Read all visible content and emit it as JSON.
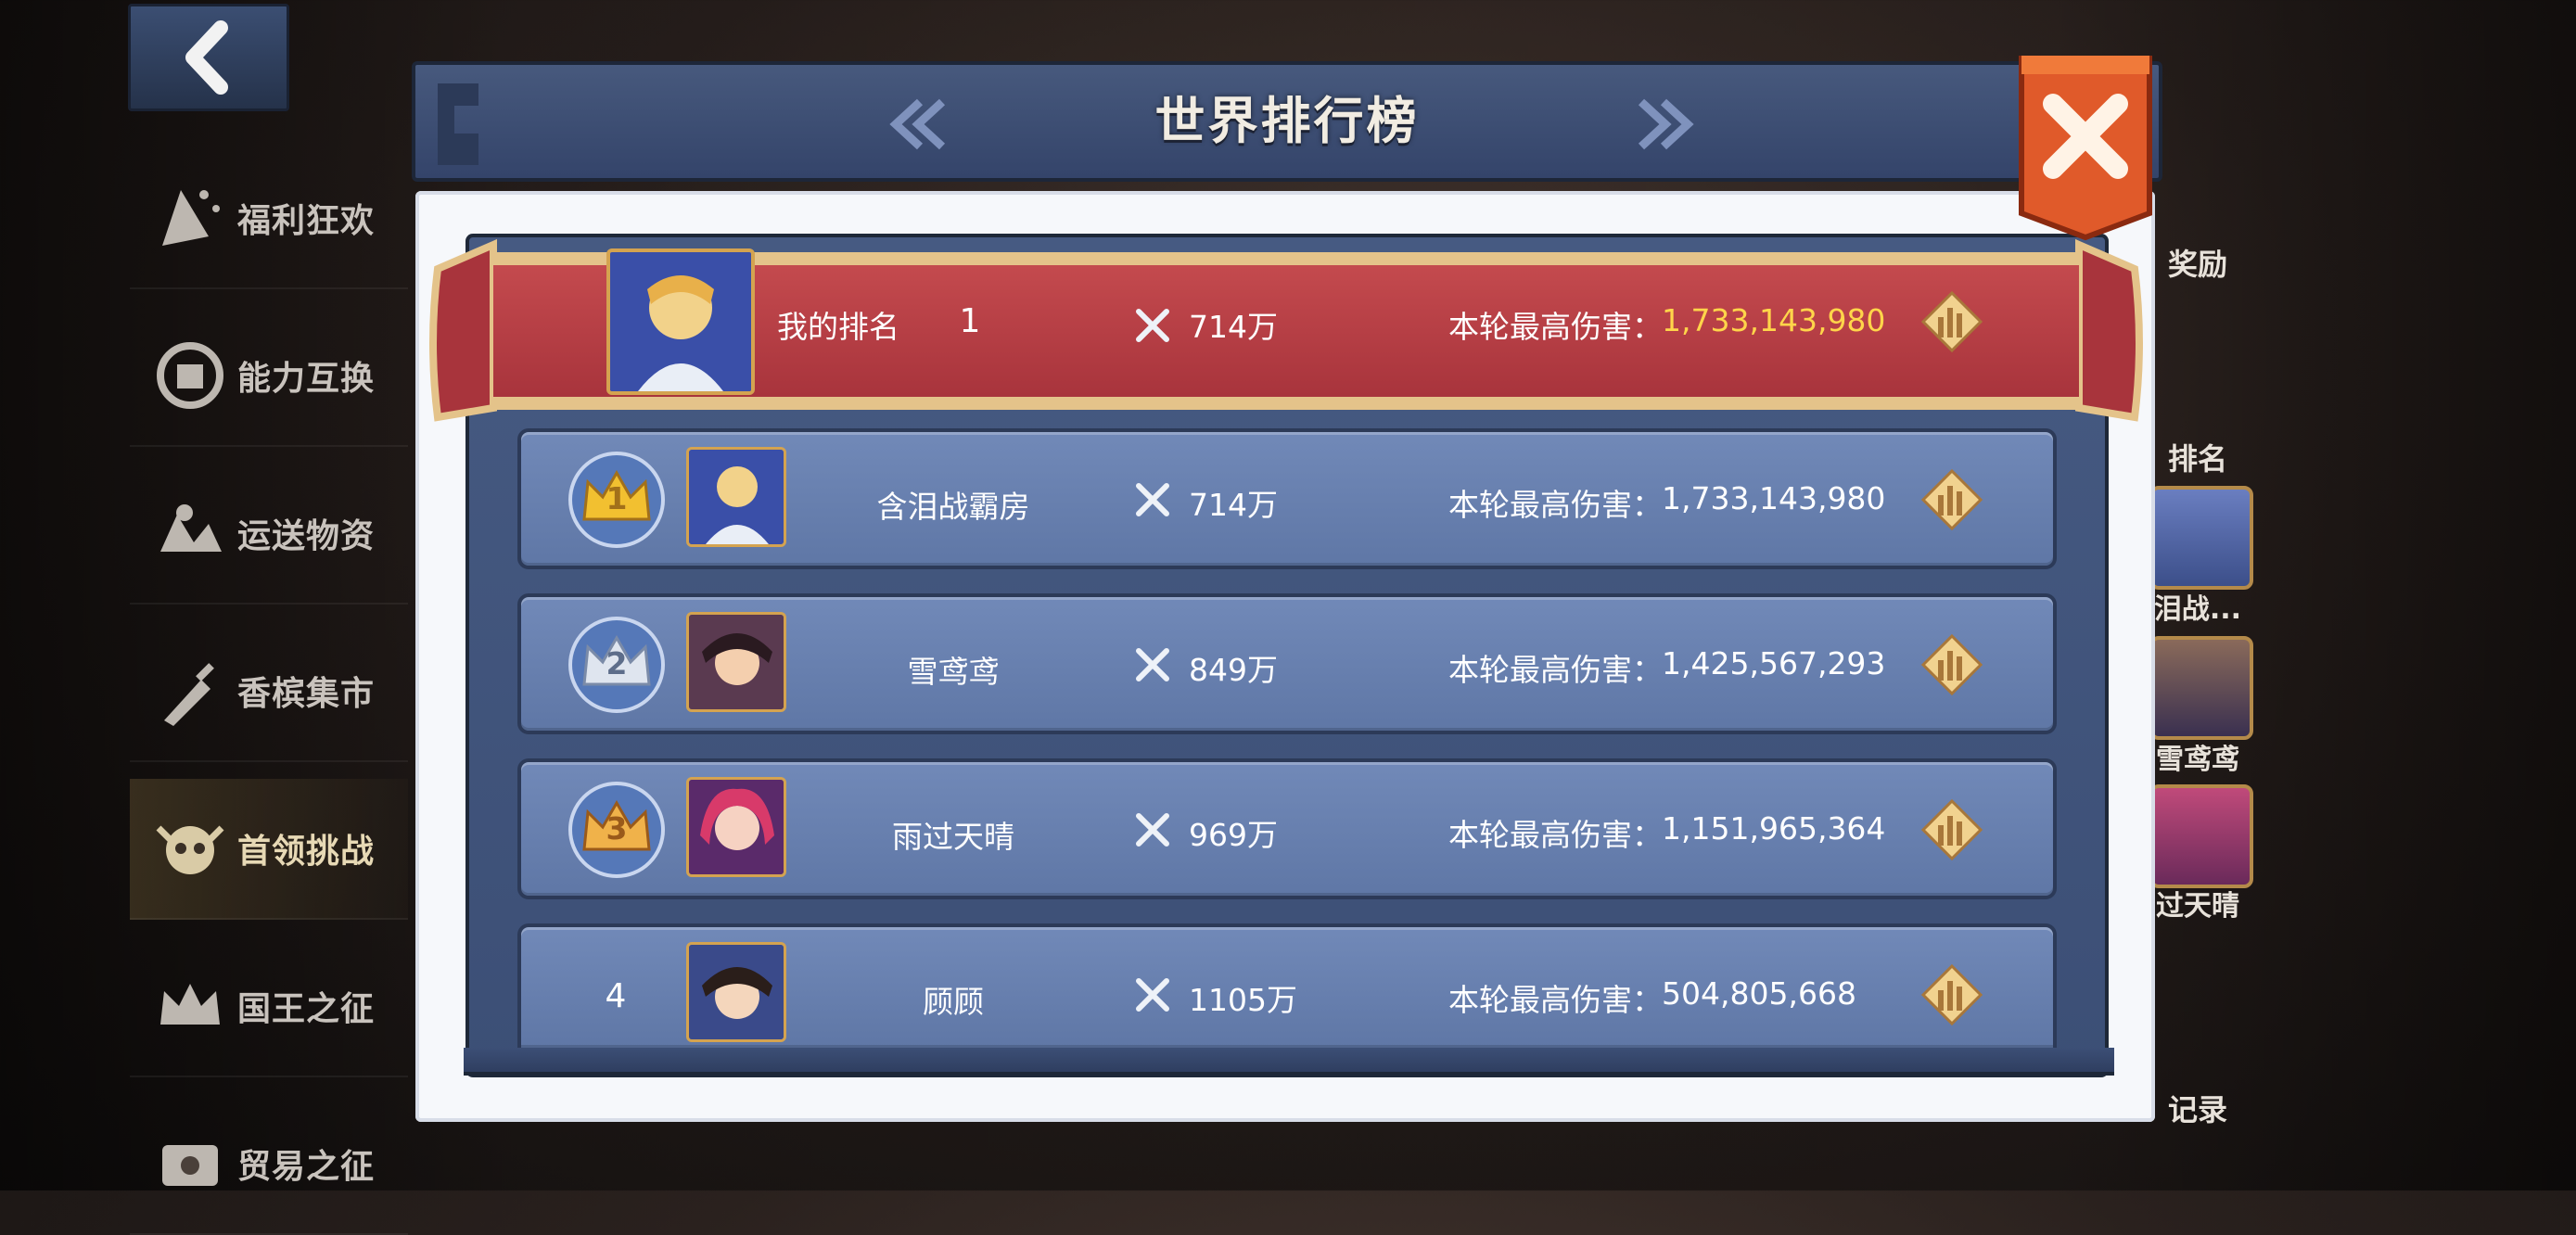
{
  "nav": {
    "back_icon": "back-arrow-icon"
  },
  "menu": {
    "items": [
      {
        "label": "福利狂欢",
        "icon": "party-icon",
        "active": false
      },
      {
        "label": "能力互换",
        "icon": "swap-icon",
        "active": false
      },
      {
        "label": "运送物资",
        "icon": "map-icon",
        "active": false
      },
      {
        "label": "香槟集市",
        "icon": "champagne-icon",
        "active": false
      },
      {
        "label": "首领挑战",
        "icon": "skull-icon",
        "active": true
      },
      {
        "label": "国王之征",
        "icon": "crown-icon",
        "active": false
      },
      {
        "label": "贸易之征",
        "icon": "trade-icon",
        "active": false
      }
    ]
  },
  "right_panel": {
    "reward_label": "奖励",
    "ranking_label": "排名",
    "top_names": [
      "泪战...",
      "雪鸢鸢",
      "过天晴"
    ],
    "record_label": "记录"
  },
  "leaderboard": {
    "title": "世界排行榜",
    "my_rank": {
      "label": "我的排名",
      "rank": "1",
      "power": "714万",
      "damage_label": "本轮最高伤害：",
      "damage": "1,733,143,980"
    },
    "rows": [
      {
        "rank": "1",
        "name": "含泪战霸房",
        "power": "714万",
        "damage_label": "本轮最高伤害：",
        "damage": "1,733,143,980",
        "crown": "gold"
      },
      {
        "rank": "2",
        "name": "雪鸢鸢",
        "power": "849万",
        "damage_label": "本轮最高伤害：",
        "damage": "1,425,567,293",
        "crown": "silver"
      },
      {
        "rank": "3",
        "name": "雨过天晴",
        "power": "969万",
        "damage_label": "本轮最高伤害：",
        "damage": "1,151,965,364",
        "crown": "bronze"
      },
      {
        "rank": "4",
        "name": "顾顾",
        "power": "1105万",
        "damage_label": "本轮最高伤害：",
        "damage": "504,805,668",
        "crown": "none"
      }
    ]
  },
  "colors": {
    "accent_gold": "#ffd54a",
    "banner_red": "#b43c42",
    "row_blue": "#6880b0",
    "close_orange": "#e05a2a"
  }
}
